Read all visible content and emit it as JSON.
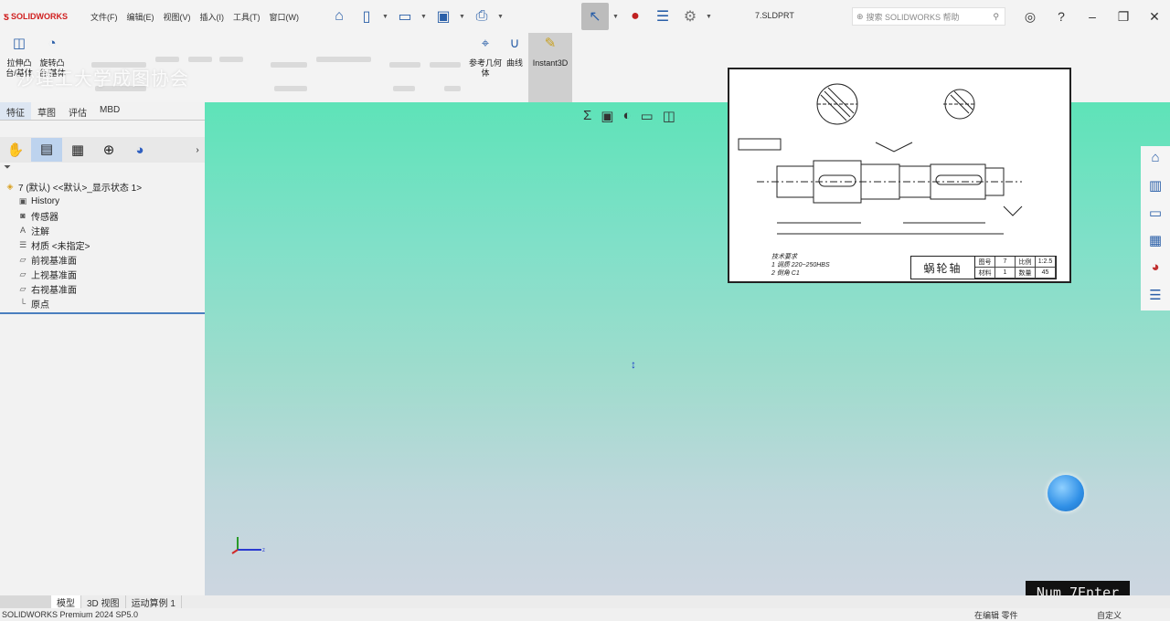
{
  "app": {
    "logo_text": "SOLIDWORKS",
    "document_title": "7.SLDPRT"
  },
  "menu": [
    "文件(F)",
    "编辑(E)",
    "视图(V)",
    "插入(I)",
    "工具(T)",
    "窗口(W)"
  ],
  "search": {
    "placeholder": "搜索 SOLIDWORKS 帮助"
  },
  "ribbon": {
    "extrude_boss": "拉伸凸台/基体",
    "revolve_boss": "旋转凸台/基体",
    "reference_geometry": "参考几何体",
    "curves": "曲线",
    "instant3d": "Instant3D"
  },
  "watermark": "沙理工大学成图协会",
  "panel_tabs": [
    "特征",
    "草图",
    "评估",
    "MBD"
  ],
  "feature_tree": {
    "root": "7 (默认) <<默认>_显示状态 1>",
    "items": [
      "History",
      "传感器",
      "注解",
      "材质 <未指定>",
      "前视基准面",
      "上视基准面",
      "右视基准面",
      "原点"
    ]
  },
  "drawing": {
    "part_name": "蜗轮轴",
    "notes": [
      "技术要求",
      "1 调质 220~250HBS",
      "2 倒角 C1"
    ],
    "title_cells": [
      "图号",
      "7",
      "比例",
      "1:2.5",
      "材料",
      "1",
      "数量",
      "45"
    ]
  },
  "keystroke_overlay": "Num 7Enter",
  "bottom_tabs": [
    "模型",
    "3D 视图",
    "运动算例 1"
  ],
  "status": {
    "left": "SOLIDWORKS Premium 2024 SP5.0",
    "editing": "在编辑 零件",
    "custom": "自定义"
  }
}
